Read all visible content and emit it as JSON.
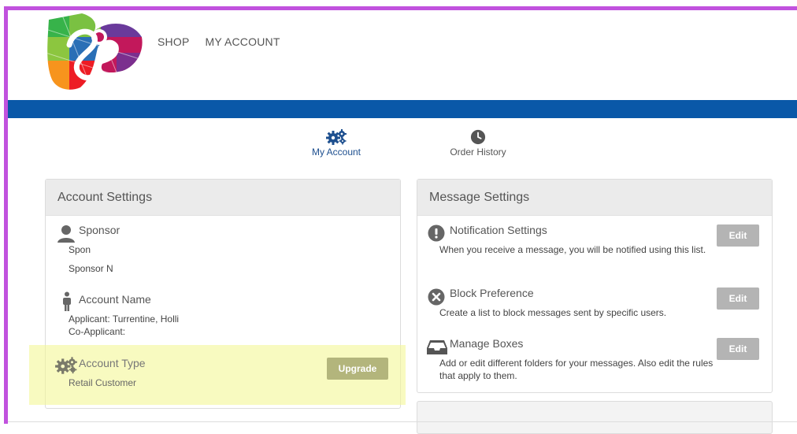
{
  "colors": {
    "frame": "#c152de",
    "brand_bar": "#0a58a8",
    "active_tab": "#1d4f8f",
    "highlight": "#f3f696",
    "edit_button": "#b4b4b4",
    "upgrade_button": "#b3b57c"
  },
  "topnav": {
    "shop": "SHOP",
    "my_account": "MY ACCOUNT"
  },
  "tabs": {
    "my_account": {
      "label": "My Account",
      "icon": "gears-icon"
    },
    "order_history": {
      "label": "Order History",
      "icon": "clock-icon"
    }
  },
  "account_settings": {
    "title": "Account Settings",
    "sponsor": {
      "title": "Sponsor",
      "line1": "Spon",
      "line2": "Sponsor N"
    },
    "account_name": {
      "title": "Account Name",
      "applicant": "Applicant: Turrentine, Holli",
      "co_applicant": "Co-Applicant:"
    },
    "account_type": {
      "title": "Account Type",
      "value": "Retail Customer",
      "button": "Upgrade"
    }
  },
  "message_settings": {
    "title": "Message Settings",
    "notification": {
      "title": "Notification Settings",
      "text": "When you receive a message, you will be notified using this list.",
      "button": "Edit"
    },
    "block": {
      "title": "Block Preference",
      "text": "Create a list to block messages sent by specific users.",
      "button": "Edit"
    },
    "boxes": {
      "title": "Manage Boxes",
      "text": "Add or edit different folders for your messages. Also edit the rules that apply to them.",
      "button": "Edit"
    }
  }
}
